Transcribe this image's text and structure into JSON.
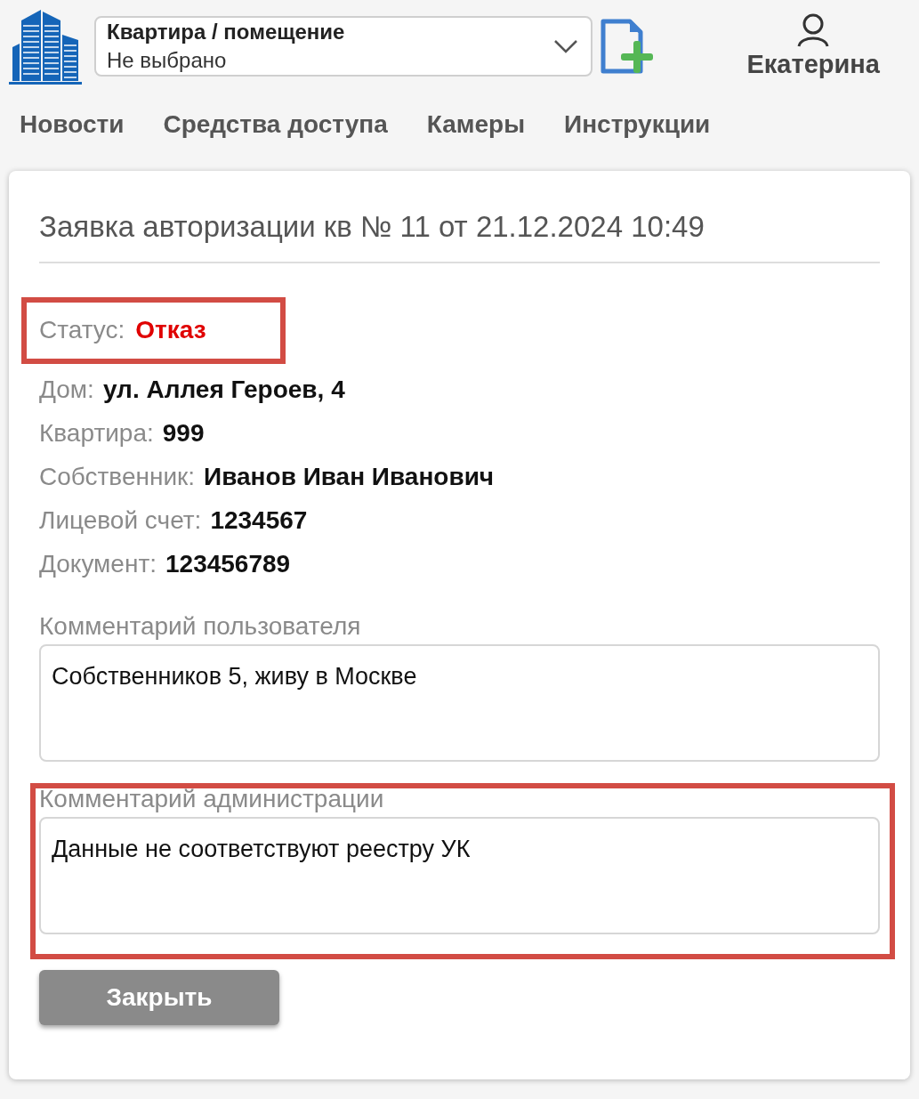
{
  "header": {
    "apartment_select": {
      "label": "Квартира / помещение",
      "value": "Не выбрано"
    },
    "user": {
      "name": "Екатерина"
    }
  },
  "nav": [
    {
      "label": "Новости"
    },
    {
      "label": "Средства доступа"
    },
    {
      "label": "Камеры"
    },
    {
      "label": "Инструкции"
    }
  ],
  "request": {
    "title": "Заявка авторизации кв № 11 от 21.12.2024 10:49",
    "status": {
      "label": "Статус:",
      "value": "Отказ",
      "kind": "rejected",
      "highlighted": true
    },
    "fields": [
      {
        "label": "Дом:",
        "value": "ул. Аллея Героев, 4"
      },
      {
        "label": "Квартира:",
        "value": "999"
      },
      {
        "label": "Собственник:",
        "value": "Иванов Иван Иванович"
      },
      {
        "label": "Лицевой счет:",
        "value": "1234567"
      },
      {
        "label": "Документ:",
        "value": "123456789"
      }
    ],
    "comments": [
      {
        "label": "Комментарий пользователя",
        "text": "Собственников 5, живу в Москве",
        "highlighted": false
      },
      {
        "label": "Комментарий администрации",
        "text": "Данные не соответствуют реестру УК",
        "highlighted": true
      }
    ],
    "close_button": "Закрыть"
  }
}
